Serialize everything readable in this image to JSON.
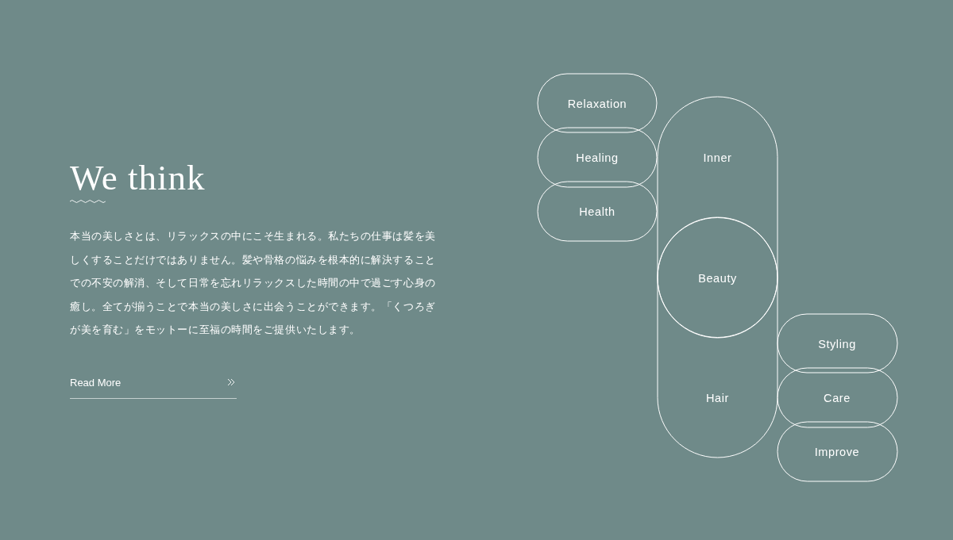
{
  "heading": "We think",
  "body": "本当の美しさとは、リラックスの中にこそ生まれる。私たちの仕事は髪を美しくすることだけではありません。髪や骨格の悩みを根本的に解決することでの不安の解消、そして日常を忘れリラックスした時間の中で過ごす心身の癒し。全てが揃うことで本当の美しさに出会うことができます。「くつろぎが美を育む」をモットーに至福の時間をご提供いたします。",
  "read_more": {
    "label": "Read More"
  },
  "diagram": {
    "nodes": [
      {
        "label": "Relaxation",
        "kind": "pill"
      },
      {
        "label": "Healing",
        "kind": "pill"
      },
      {
        "label": "Health",
        "kind": "pill"
      },
      {
        "label": "Inner",
        "kind": "stadium"
      },
      {
        "label": "Beauty",
        "kind": "circle"
      },
      {
        "label": "Hair",
        "kind": "stadium"
      },
      {
        "label": "Styling",
        "kind": "pill"
      },
      {
        "label": "Care",
        "kind": "pill"
      },
      {
        "label": "Improve",
        "kind": "pill"
      }
    ]
  }
}
